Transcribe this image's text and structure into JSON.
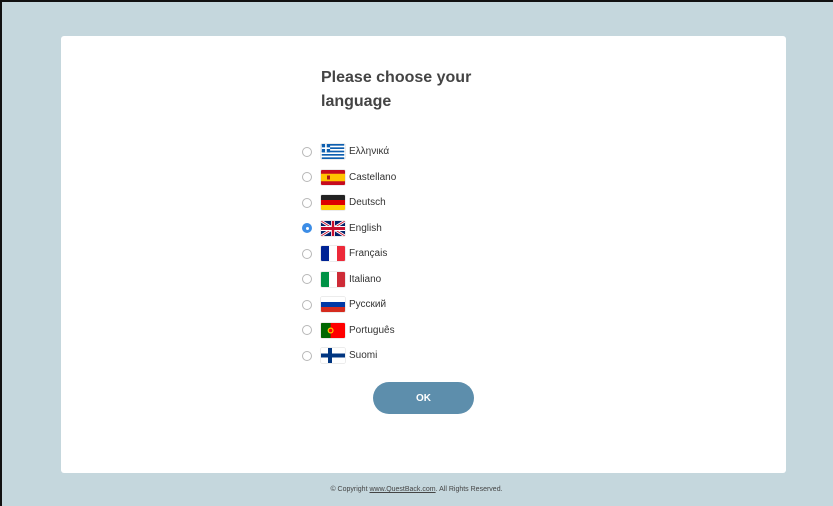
{
  "page": {
    "title": "Please choose your language",
    "ok_label": "OK"
  },
  "languages": [
    {
      "label": "Ελληνικά",
      "flag": "greece-flag-icon",
      "selected": false
    },
    {
      "label": "Castellano",
      "flag": "spain-flag-icon",
      "selected": false
    },
    {
      "label": "Deutsch",
      "flag": "germany-flag-icon",
      "selected": false
    },
    {
      "label": "English",
      "flag": "uk-flag-icon",
      "selected": true
    },
    {
      "label": "Français",
      "flag": "france-flag-icon",
      "selected": false
    },
    {
      "label": "Italiano",
      "flag": "italy-flag-icon",
      "selected": false
    },
    {
      "label": "Русский",
      "flag": "russia-flag-icon",
      "selected": false
    },
    {
      "label": "Português",
      "flag": "portugal-flag-icon",
      "selected": false
    },
    {
      "label": "Suomi",
      "flag": "finland-flag-icon",
      "selected": false
    }
  ],
  "footer": {
    "prefix": "© Copyright ",
    "link_text": "www.QuestBack.com",
    "suffix": ". All Rights Reserved."
  },
  "colors": {
    "background": "#c5d7dd",
    "button": "#5d8eac",
    "radio_selected": "#3c8de6"
  }
}
